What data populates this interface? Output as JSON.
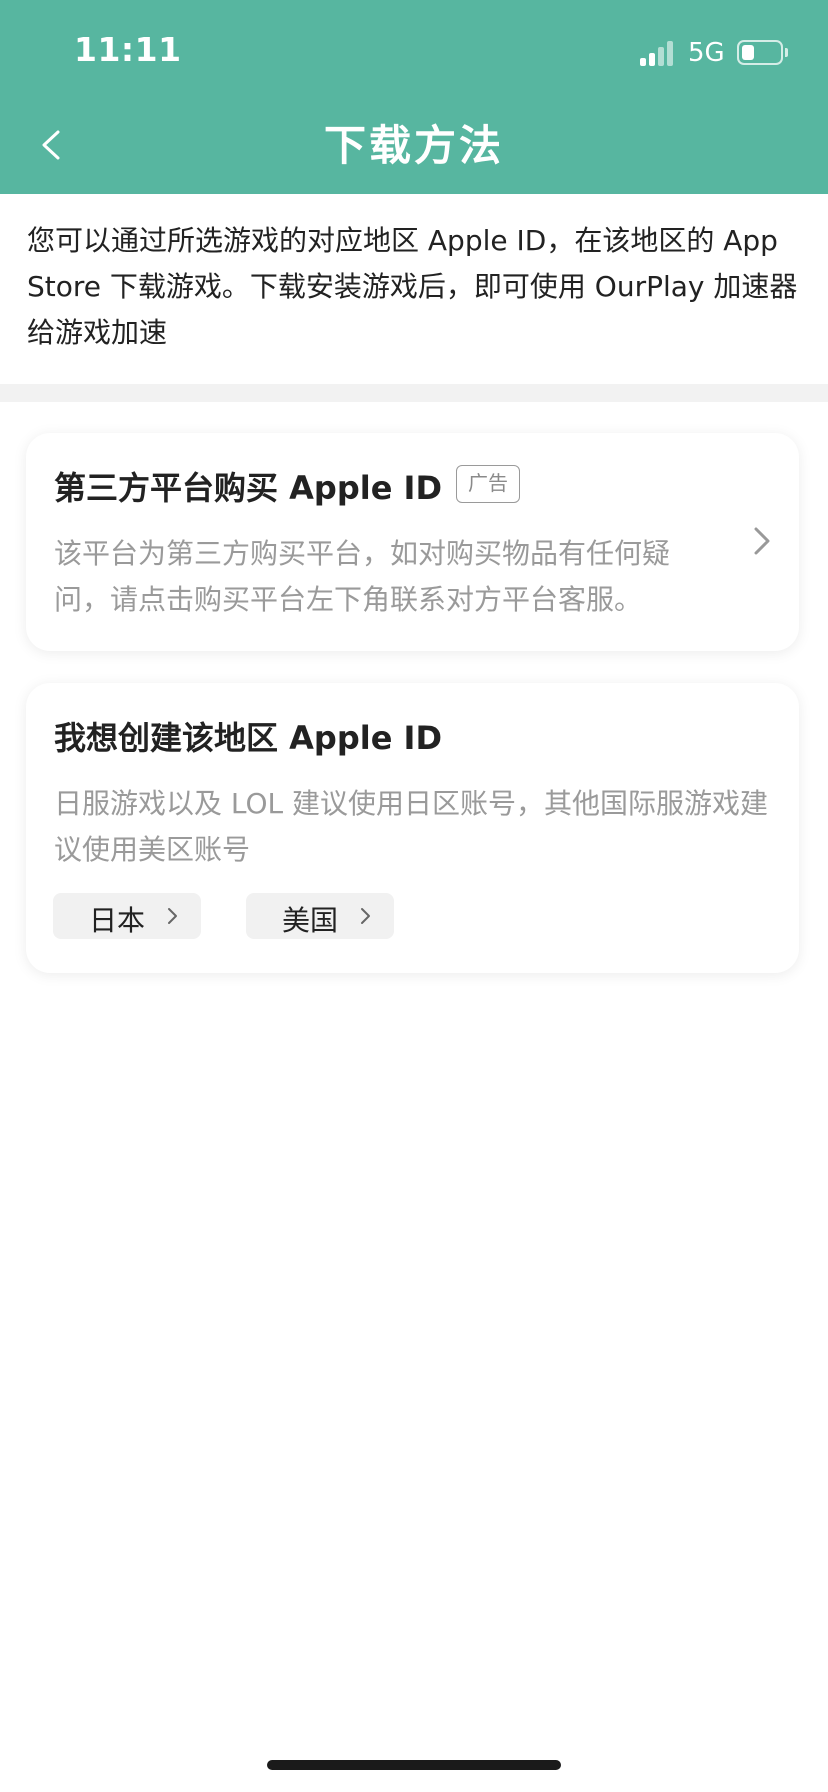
{
  "status_bar": {
    "time": "11:11",
    "network": "5G",
    "signal_bars_active": 2,
    "signal_bars_total": 4
  },
  "header": {
    "title": "下载方法",
    "background_color": "#57b6a0"
  },
  "intro": {
    "text": "您可以通过所选游戏的对应地区 Apple ID，在该地区的 App Store 下载游戏。下载安装游戏后，即可使用 OurPlay 加速器给游戏加速"
  },
  "buy_card": {
    "title": "第三方平台购买 Apple ID",
    "badge": "广告",
    "description": "该平台为第三方购买平台，如对购买物品有任何疑问，请点击购买平台左下角联系对方平台客服。"
  },
  "create_card": {
    "title": "我想创建该地区 Apple ID",
    "description": "日服游戏以及 LOL 建议使用日区账号，其他国际服游戏建议使用美区账号",
    "regions": [
      {
        "label": "日本"
      },
      {
        "label": "美国"
      }
    ]
  }
}
